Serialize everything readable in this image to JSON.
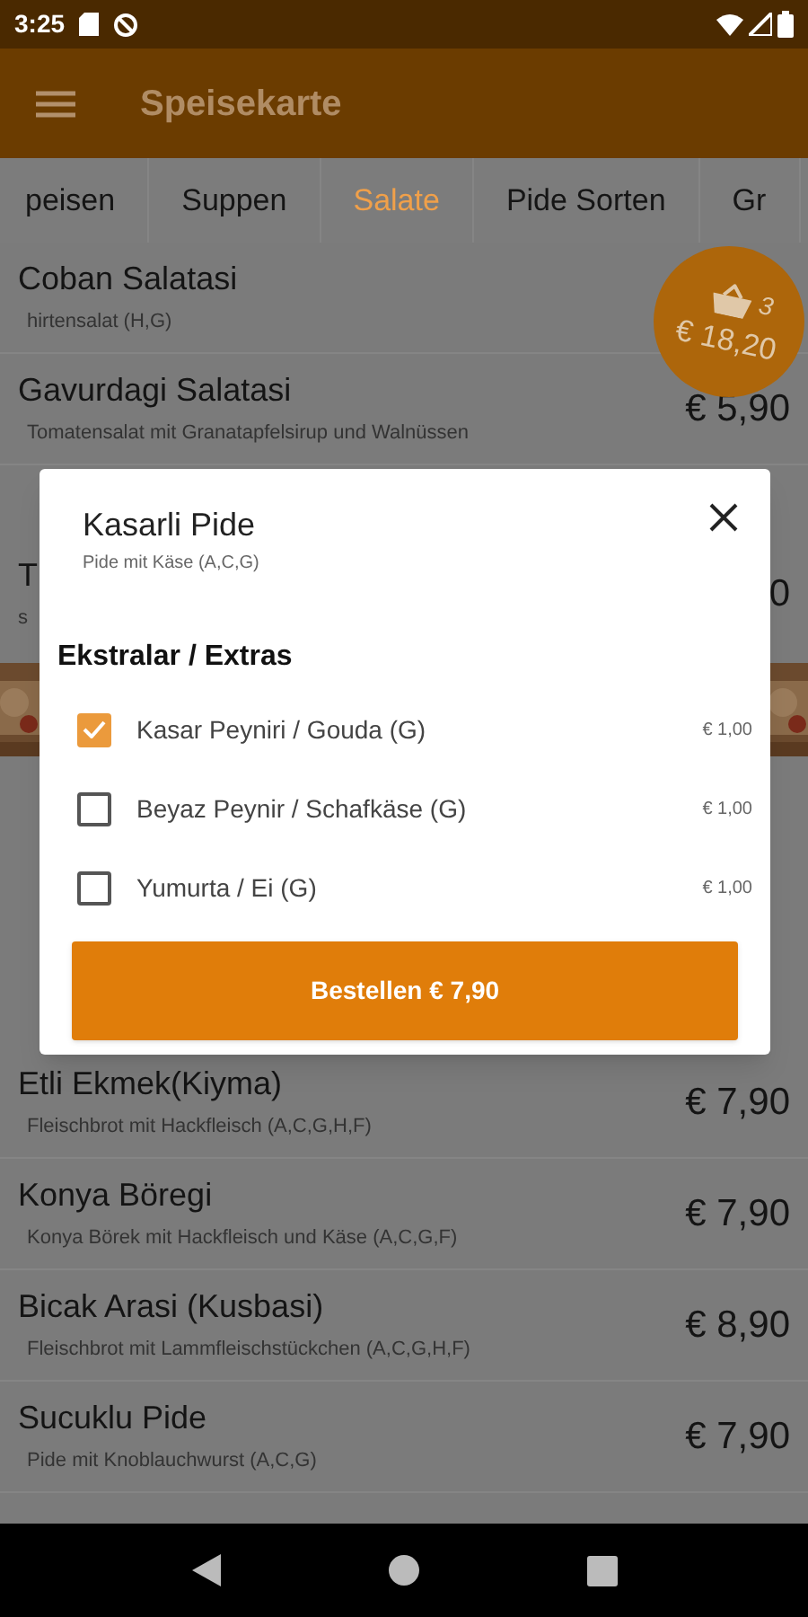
{
  "status_bar": {
    "time": "3:25"
  },
  "app_bar": {
    "title": "Speisekarte"
  },
  "tabs": [
    {
      "label": "peisen",
      "selected": false
    },
    {
      "label": "Suppen",
      "selected": false
    },
    {
      "label": "Salate",
      "selected": true
    },
    {
      "label": "Pide Sorten",
      "selected": false
    },
    {
      "label": "Gr",
      "selected": false
    }
  ],
  "cart": {
    "count": "3",
    "total": "€ 18,20"
  },
  "menu_items": [
    {
      "kind": "item",
      "name": "Coban Salatasi",
      "description": "hirtensalat (H,G)"
    },
    {
      "kind": "item",
      "name": "Gavurdagi Salatasi",
      "description": "Tomatensalat mit Granatapfelsirup und Walnüssen",
      "price": "€ 5,90"
    },
    {
      "kind": "covered",
      "name": "T",
      "description": "s",
      "price": "0"
    },
    {
      "kind": "item",
      "name": "Etli Ekmek(Kiyma)",
      "description": "Fleischbrot mit Hackfleisch (A,C,G,H,F)",
      "price": "€ 7,90"
    },
    {
      "kind": "item",
      "name": "Konya Böregi",
      "description": "Konya Börek mit Hackfleisch und  Käse (A,C,G,F)",
      "price": "€ 7,90"
    },
    {
      "kind": "item",
      "name": "Bicak Arasi (Kusbasi)",
      "description": "Fleischbrot mit Lammfleischstückchen  (A,C,G,H,F)",
      "price": "€ 8,90"
    },
    {
      "kind": "item",
      "name": "Sucuklu Pide",
      "description": "Pide mit Knoblauchwurst (A,C,G)",
      "price": "€ 7,90"
    }
  ],
  "dialog": {
    "title": "Kasarli Pide",
    "subtitle": "Pide mit Käse (A,C,G)",
    "section": "Ekstralar / Extras",
    "options": [
      {
        "label": "Kasar Peyniri / Gouda (G)",
        "price": "€ 1,00",
        "checked": true
      },
      {
        "label": "Beyaz Peynir / Schafkäse (G)",
        "price": "€ 1,00",
        "checked": false
      },
      {
        "label": "Yumurta / Ei (G)",
        "price": "€ 1,00",
        "checked": false
      }
    ],
    "order_button": "Bestellen € 7,90"
  }
}
